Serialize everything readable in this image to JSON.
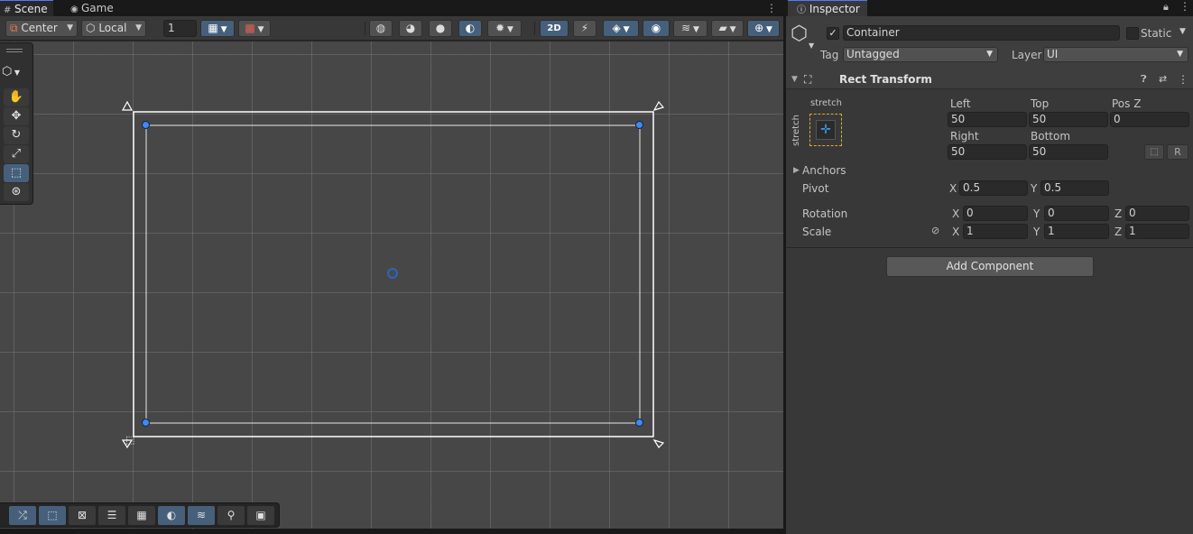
{
  "scene_tabs": [
    {
      "label": "Scene",
      "icon": "hash-icon",
      "active": true
    },
    {
      "label": "Game",
      "icon": "gamepad-icon",
      "active": false
    }
  ],
  "toolbar": {
    "pivot_mode": "Center",
    "pivot_rotation": "Local",
    "grid_snap_value": "1",
    "mode_2d": "2D"
  },
  "inspector": {
    "tab_label": "Inspector",
    "object_name": "Container",
    "static_label": "Static",
    "tag_label": "Tag",
    "tag_value": "Untagged",
    "layer_label": "Layer",
    "layer_value": "UI",
    "component_title": "Rect Transform",
    "anchor_preset_top": "stretch",
    "anchor_preset_side": "stretch",
    "left_label": "Left",
    "left_value": "50",
    "top_label": "Top",
    "top_value": "50",
    "posz_label": "Pos Z",
    "posz_value": "0",
    "right_label": "Right",
    "right_value": "50",
    "bottom_label": "Bottom",
    "bottom_value": "50",
    "raw_edit_label": "R",
    "anchors_label": "Anchors",
    "pivot_label": "Pivot",
    "pivot_x": "0.5",
    "pivot_y": "0.5",
    "rotation_label": "Rotation",
    "rotation_x": "0",
    "rotation_y": "0",
    "rotation_z": "0",
    "scale_label": "Scale",
    "scale_x": "1",
    "scale_y": "1",
    "scale_z": "1",
    "axis_x": "X",
    "axis_y": "Y",
    "axis_z": "Z",
    "add_component_label": "Add Component"
  },
  "colors": {
    "accent": "#46607c",
    "handle": "#3e8af0",
    "rect_outline": "#ffffff",
    "anchor_box": "#d7a93c"
  }
}
